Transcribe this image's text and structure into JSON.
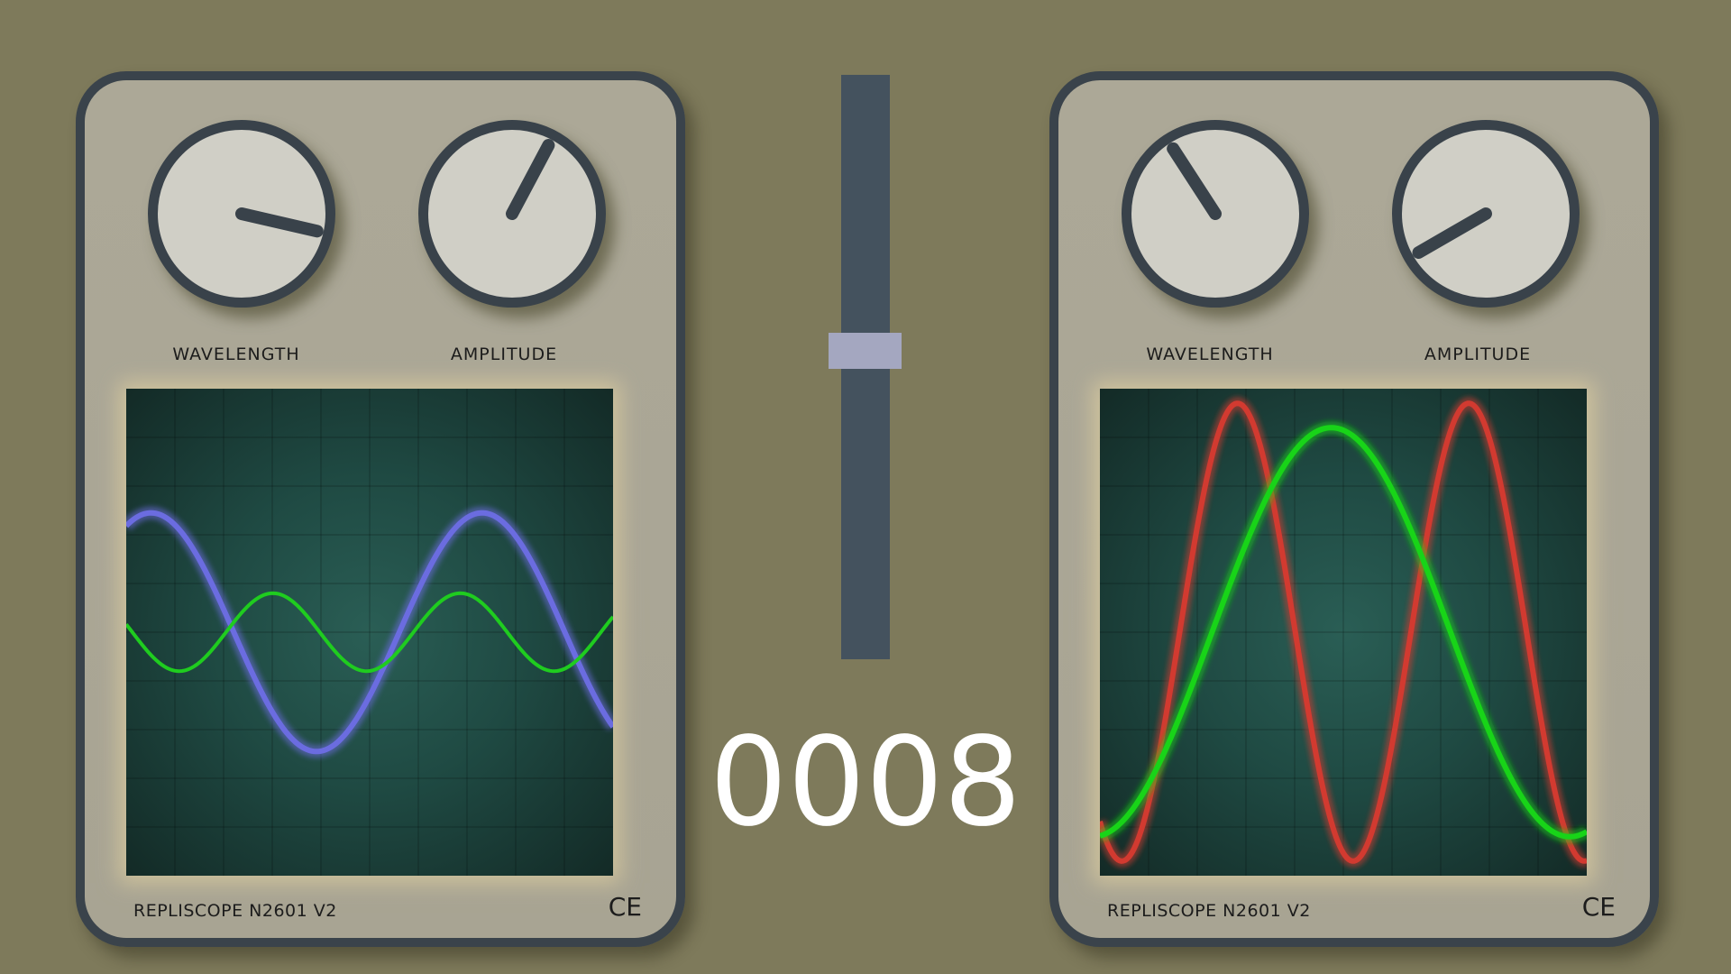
{
  "colors": {
    "background": "#7e7a5b",
    "panel": "#aca897",
    "panel_border": "#3a434b",
    "knob_face": "#d0cfc6",
    "screen": "#1f4a43",
    "fader_track": "#44525e",
    "fader_handle": "#a4a7c0",
    "counter_text": "#ffffff"
  },
  "scopes": [
    {
      "model": "REPLISCOPE N2601 V2",
      "mark": "CE",
      "knobs": [
        {
          "label": "WAVELENGTH",
          "icon": "knob-dial-icon",
          "angle_deg": -77
        },
        {
          "label": "AMPLITUDE",
          "icon": "knob-dial-icon",
          "angle_deg": 208
        }
      ],
      "traces": [
        {
          "name": "",
          "color": "#6b6ce0",
          "glow": true,
          "amplitude": 0.245,
          "wavelength": 0.68,
          "phase": 0.35
        },
        {
          "name": "",
          "color": "#1fcc1f",
          "glow": false,
          "amplitude": 0.08,
          "wavelength": 0.385,
          "phase": 0.935
        }
      ]
    },
    {
      "model": "REPLISCOPE N2601 V2",
      "mark": "CE",
      "knobs": [
        {
          "label": "WAVELENGTH",
          "icon": "knob-dial-icon",
          "angle_deg": 147
        },
        {
          "label": "AMPLITUDE",
          "icon": "knob-dial-icon",
          "angle_deg": 60
        }
      ],
      "traces": [
        {
          "name": "",
          "color": "#d23a30",
          "glow": true,
          "amplitude": 0.47,
          "wavelength": 0.475,
          "phase": 1.31
        },
        {
          "name": "",
          "color": "#18d418",
          "glow": true,
          "amplitude": 0.42,
          "wavelength": 0.98,
          "phase": 1.53
        }
      ]
    }
  ],
  "fader": {
    "level": 0.53,
    "icon": "fader-handle-icon"
  },
  "counter": {
    "value": "0008"
  }
}
